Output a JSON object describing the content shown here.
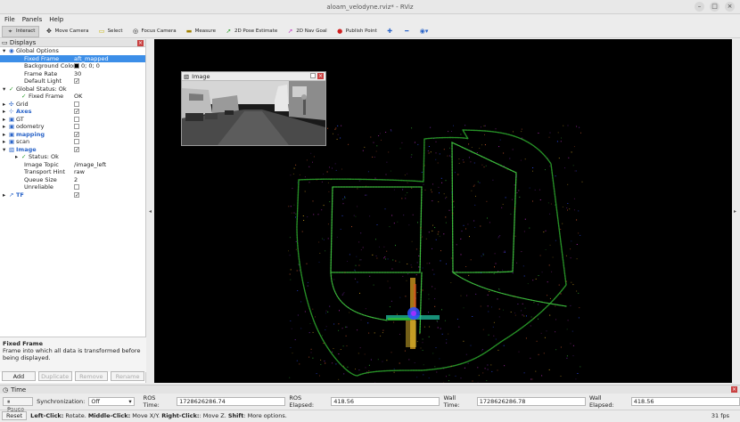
{
  "window": {
    "title": "aloam_velodyne.rviz* - RViz",
    "buttons": [
      "–",
      "□",
      "×"
    ]
  },
  "menu": [
    "File",
    "Panels",
    "Help"
  ],
  "toolbar": [
    {
      "label": "Interact",
      "icon": "cursor-icon",
      "active": true
    },
    {
      "label": "Move Camera",
      "icon": "move-camera-icon"
    },
    {
      "label": "Select",
      "icon": "select-icon"
    },
    {
      "label": "Focus Camera",
      "icon": "focus-camera-icon"
    },
    {
      "label": "Measure",
      "icon": "measure-icon"
    },
    {
      "label": "2D Pose Estimate",
      "icon": "pose-estimate-icon"
    },
    {
      "label": "2D Nav Goal",
      "icon": "nav-goal-icon"
    },
    {
      "label": "Publish Point",
      "icon": "publish-point-icon"
    }
  ],
  "displays": {
    "title": "Displays",
    "rows": [
      {
        "indent": 0,
        "exp": "▾",
        "icon": "◉",
        "label": "Global Options"
      },
      {
        "indent": 2,
        "label": "Fixed Frame",
        "value": "aft_mapped",
        "selected": true
      },
      {
        "indent": 2,
        "label": "Background Color",
        "value": "0; 0; 0",
        "swatch": "#000000"
      },
      {
        "indent": 2,
        "label": "Frame Rate",
        "value": "30"
      },
      {
        "indent": 2,
        "label": "Default Light",
        "check": true
      },
      {
        "indent": 0,
        "exp": "▾",
        "icon": "✓",
        "label": "Global Status: Ok"
      },
      {
        "indent": 2,
        "icon": "✓",
        "label": "Fixed Frame",
        "value": "OK"
      },
      {
        "indent": 0,
        "exp": "▸",
        "icon": "✣",
        "label": "Grid",
        "check": false
      },
      {
        "indent": 0,
        "exp": "▸",
        "icon": "⊹",
        "label": "Axes",
        "check": true,
        "blue": true
      },
      {
        "indent": 0,
        "exp": "▸",
        "icon": "▣",
        "label": "GT",
        "check": false
      },
      {
        "indent": 0,
        "exp": "▸",
        "icon": "▣",
        "label": "odometry",
        "check": false
      },
      {
        "indent": 0,
        "exp": "▸",
        "icon": "▣",
        "label": "mapping",
        "check": true,
        "blue": true
      },
      {
        "indent": 0,
        "exp": "▸",
        "icon": "▣",
        "label": "scan",
        "check": false
      },
      {
        "indent": 0,
        "exp": "▾",
        "icon": "▧",
        "label": "Image",
        "check": true,
        "blue": true
      },
      {
        "indent": 2,
        "exp": "▸",
        "icon": "✓",
        "label": "Status: Ok"
      },
      {
        "indent": 2,
        "label": "Image Topic",
        "value": "/image_left"
      },
      {
        "indent": 2,
        "label": "Transport Hint",
        "value": "raw"
      },
      {
        "indent": 2,
        "label": "Queue Size",
        "value": "2"
      },
      {
        "indent": 2,
        "label": "Unreliable",
        "check": false
      },
      {
        "indent": 0,
        "exp": "▸",
        "icon": "↗",
        "label": "TF",
        "check": true,
        "blue": true
      }
    ],
    "desc_title": "Fixed Frame",
    "desc_text": "Frame into which all data is transformed before being displayed.",
    "buttons": {
      "add": "Add",
      "duplicate": "Duplicate",
      "remove": "Remove",
      "rename": "Rename"
    }
  },
  "image_panel": {
    "title": "Image"
  },
  "time": {
    "title": "Time",
    "pause": "Pause",
    "sync_label": "Synchronization:",
    "sync_value": "Off",
    "ros_time_label": "ROS Time:",
    "ros_time": "1728626286.74",
    "ros_elapsed_label": "ROS Elapsed:",
    "ros_elapsed": "418.56",
    "wall_time_label": "Wall Time:",
    "wall_time": "1728626286.78",
    "wall_elapsed_label": "Wall Elapsed:",
    "wall_elapsed": "418.56"
  },
  "status": {
    "reset": "Reset",
    "hint_b1": "Left-Click:",
    "hint_t1": " Rotate. ",
    "hint_b2": "Middle-Click:",
    "hint_t2": " Move X/Y. ",
    "hint_b3": "Right-Click:",
    "hint_t3": ": Move Z. ",
    "hint_b4": "Shift",
    "hint_t4": ": More options.",
    "fps": "31 fps"
  }
}
